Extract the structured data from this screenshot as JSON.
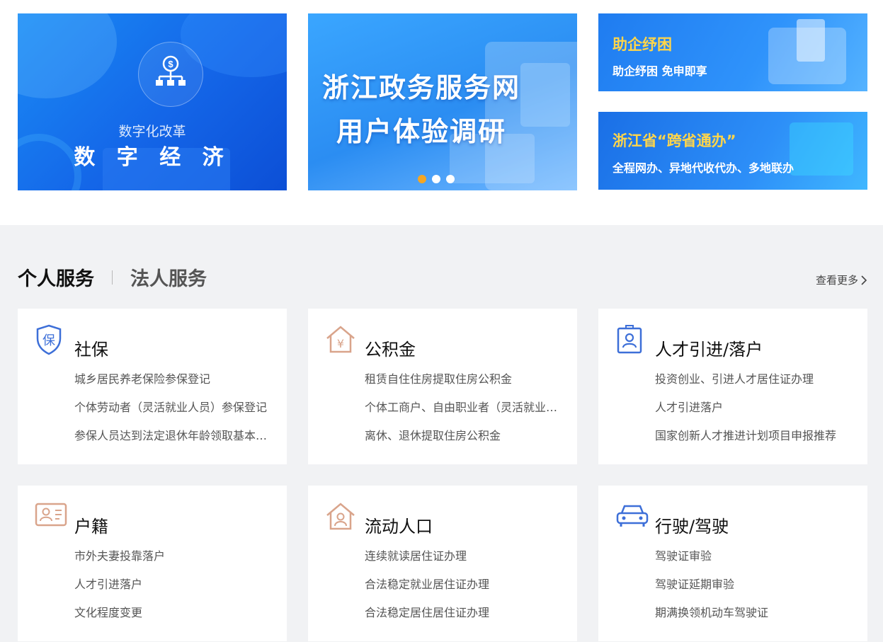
{
  "banners": {
    "digital": {
      "subtitle": "数字化改革",
      "title": "数 字 经 济"
    },
    "survey": {
      "line1": "浙江政务服务网",
      "line2": "用户体验调研",
      "dots": 3,
      "active_dot": 0
    },
    "relief": {
      "title": "助企纾困",
      "subtitle": "助企纾困 免申即享"
    },
    "crossprov": {
      "title": "浙江省“跨省通办”",
      "subtitle": "全程网办、异地代收代办、多地联办"
    }
  },
  "tabs": {
    "personal": "个人服务",
    "legal": "法人服务",
    "more": "查看更多"
  },
  "cards": [
    {
      "title": "社保",
      "icon": "shield-bao-icon",
      "links": [
        "城乡居民养老保险参保登记",
        "个体劳动者（灵活就业人员）参保登记",
        "参保人员达到法定退休年龄领取基本养老金"
      ]
    },
    {
      "title": "公积金",
      "icon": "house-yuan-icon",
      "links": [
        "租赁自住住房提取住房公积金",
        "个体工商户、自由职业者（灵活就业人员）缴存",
        "离休、退休提取住房公积金"
      ]
    },
    {
      "title": "人才引进/落户",
      "icon": "id-badge-icon",
      "links": [
        "投资创业、引进人才居住证办理",
        "人才引进落户",
        "国家创新人才推进计划项目申报推荐"
      ]
    },
    {
      "title": "户籍",
      "icon": "id-card-icon",
      "links": [
        "市外夫妻投靠落户",
        "人才引进落户",
        "文化程度变更"
      ]
    },
    {
      "title": "流动人口",
      "icon": "house-person-icon",
      "links": [
        "连续就读居住证办理",
        "合法稳定就业居住证办理",
        "合法稳定居住居住证办理"
      ]
    },
    {
      "title": "行驶/驾驶",
      "icon": "car-icon",
      "links": [
        "驾驶证审验",
        "驾驶证延期审验",
        "期满换领机动车驾驶证"
      ]
    }
  ]
}
